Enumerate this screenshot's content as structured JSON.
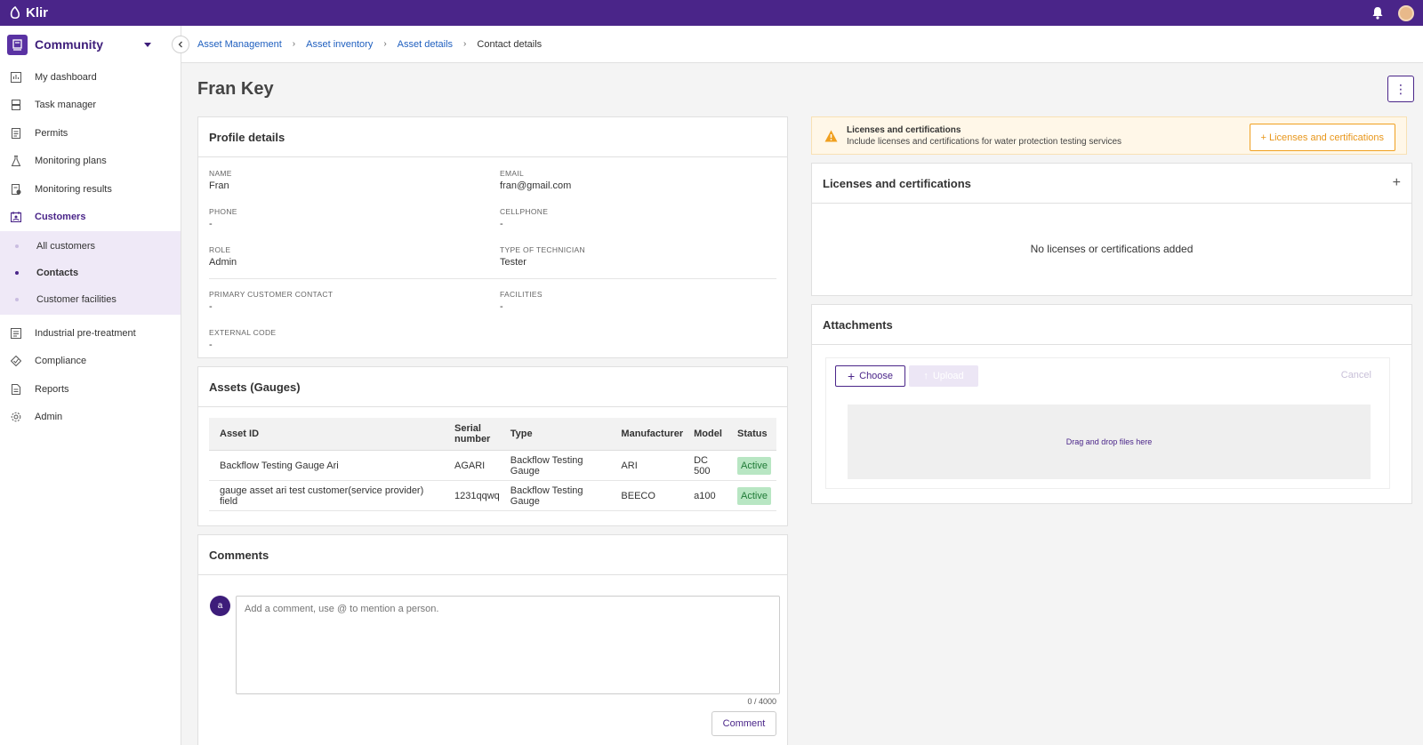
{
  "app": {
    "name": "Klir"
  },
  "sidebar": {
    "community": "Community",
    "items": [
      {
        "label": "My dashboard",
        "icon": "dashboard-icon"
      },
      {
        "label": "Task manager",
        "icon": "task-icon"
      },
      {
        "label": "Permits",
        "icon": "document-icon"
      },
      {
        "label": "Monitoring plans",
        "icon": "flask-icon"
      },
      {
        "label": "Monitoring results",
        "icon": "results-icon"
      },
      {
        "label": "Customers",
        "icon": "customers-icon",
        "active": true
      }
    ],
    "subitems": [
      {
        "label": "All customers"
      },
      {
        "label": "Contacts",
        "active": true
      },
      {
        "label": "Customer facilities"
      }
    ],
    "items2": [
      {
        "label": "Industrial pre-treatment",
        "icon": "document-icon"
      },
      {
        "label": "Compliance",
        "icon": "compliance-icon"
      },
      {
        "label": "Reports",
        "icon": "report-icon"
      },
      {
        "label": "Admin",
        "icon": "gear-icon"
      }
    ]
  },
  "breadcrumb": [
    "Asset Management",
    "Asset inventory",
    "Asset details",
    "Contact details"
  ],
  "page": {
    "title": "Fran Key"
  },
  "profile": {
    "title": "Profile details",
    "name_label": "NAME",
    "name": "Fran",
    "email_label": "EMAIL",
    "email": "fran@gmail.com",
    "phone_label": "PHONE",
    "phone": "-",
    "cellphone_label": "CELLPHONE",
    "cellphone": "-",
    "role_label": "ROLE",
    "role": "Admin",
    "tech_label": "TYPE OF TECHNICIAN",
    "tech": "Tester",
    "primary_label": "PRIMARY CUSTOMER CONTACT",
    "primary": "-",
    "facilities_label": "FACILITIES",
    "facilities": "-",
    "external_label": "EXTERNAL CODE",
    "external": "-"
  },
  "assets": {
    "title": "Assets (Gauges)",
    "columns": [
      "Asset ID",
      "Serial number",
      "Type",
      "Manufacturer",
      "Model",
      "Status"
    ],
    "rows": [
      [
        "Backflow Testing Gauge Ari",
        "AGARI",
        "Backflow Testing Gauge",
        "ARI",
        "DC 500",
        "Active"
      ],
      [
        "gauge asset ari test customer(service provider) field",
        "1231qqwq",
        "Backflow Testing Gauge",
        "BEECO",
        "a100",
        "Active"
      ]
    ],
    "status_color": "#b8e6c3"
  },
  "comments": {
    "title": "Comments",
    "avatar_letter": "a",
    "placeholder": "Add a comment, use @ to mention a person.",
    "counter": "0 / 4000",
    "button": "Comment"
  },
  "alert": {
    "title": "Licenses and certifications",
    "text": "Include licenses and certifications for water protection testing services",
    "button": "+ Licenses and certifications",
    "color": "#f0a020"
  },
  "licenses": {
    "title": "Licenses and certifications",
    "empty": "No licenses or certifications added"
  },
  "attachments": {
    "title": "Attachments",
    "choose": "Choose",
    "upload": "Upload",
    "cancel": "Cancel",
    "dropzone": "Drag and drop files here"
  },
  "colors": {
    "brand": "#4a2589",
    "link": "#1f5fbf"
  }
}
